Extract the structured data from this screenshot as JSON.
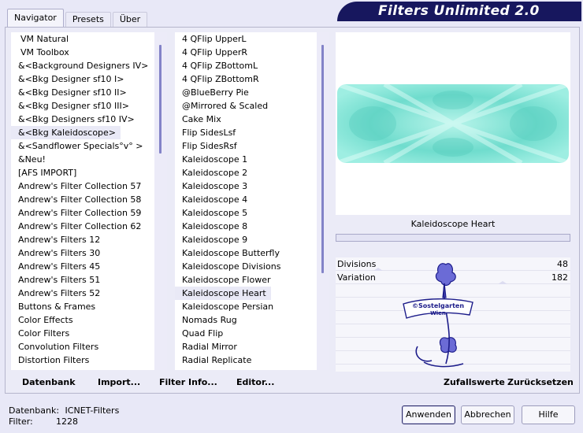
{
  "window": {
    "title": "Filters Unlimited 2.0"
  },
  "tabs": [
    {
      "label": "Navigator",
      "active": true
    },
    {
      "label": "Presets",
      "active": false
    },
    {
      "label": "Über",
      "active": false
    }
  ],
  "categories": {
    "selected": "&<Bkg Kaleidoscope>",
    "items": [
      "VM Natural",
      "VM Toolbox",
      "&<Background Designers IV>",
      "&<Bkg Designer sf10 I>",
      "&<Bkg Designer sf10 II>",
      "&<Bkg Designer sf10 III>",
      "&<Bkg Designers sf10 IV>",
      "&<Bkg Kaleidoscope>",
      "&<Sandflower Specials°v° >",
      "&Neu!",
      "[AFS IMPORT]",
      "Andrew's Filter Collection 57",
      "Andrew's Filter Collection 58",
      "Andrew's Filter Collection 59",
      "Andrew's Filter Collection 62",
      "Andrew's Filters 12",
      "Andrew's Filters 30",
      "Andrew's Filters 45",
      "Andrew's Filters 51",
      "Andrew's Filters 52",
      "Buttons & Frames",
      "Color Effects",
      "Color Filters",
      "Convolution Filters",
      "Distortion Filters"
    ]
  },
  "filters": {
    "selected": "Kaleidoscope Heart",
    "items": [
      "4 QFlip UpperL",
      "4 QFlip UpperR",
      "4 QFlip ZBottomL",
      "4 QFlip ZBottomR",
      "@BlueBerry Pie",
      "@Mirrored & Scaled",
      "Cake Mix",
      "Flip SidesLsf",
      "Flip SidesRsf",
      "Kaleidoscope 1",
      "Kaleidoscope 2",
      "Kaleidoscope 3",
      "Kaleidoscope 4",
      "Kaleidoscope 5",
      "Kaleidoscope 8",
      "Kaleidoscope 9",
      "Kaleidoscope Butterfly",
      "Kaleidoscope Divisions",
      "Kaleidoscope Flower",
      "Kaleidoscope Heart",
      "Kaleidoscope Persian",
      "Nomads Rug",
      "Quad Flip",
      "Radial Mirror",
      "Radial Replicate"
    ]
  },
  "preview": {
    "filter_name": "Kaleidoscope Heart",
    "tile_color": "#8ee8dc"
  },
  "parameters": [
    {
      "name": "Divisions",
      "value": "48"
    },
    {
      "name": "Variation",
      "value": "182"
    }
  ],
  "watermark": {
    "text_top": "©Sostelgarten",
    "text_bottom": "Wien"
  },
  "left_buttons": {
    "database": "Datenbank",
    "import": "Import...",
    "filter_info": "Filter Info...",
    "editor": "Editor..."
  },
  "right_buttons": {
    "random": "Zufallswerte",
    "reset": "Zurücksetzen"
  },
  "status": {
    "database_label": "Datenbank:",
    "database_value": "ICNET-Filters",
    "filter_label": "Filter:",
    "filter_value": "1228"
  },
  "dialog_buttons": {
    "apply": "Anwenden",
    "cancel": "Abbrechen",
    "help": "Hilfe"
  },
  "colors": {
    "accent": "#17175e",
    "selection": "#e9e9f6",
    "scroll_thumb": "#8383c8"
  }
}
